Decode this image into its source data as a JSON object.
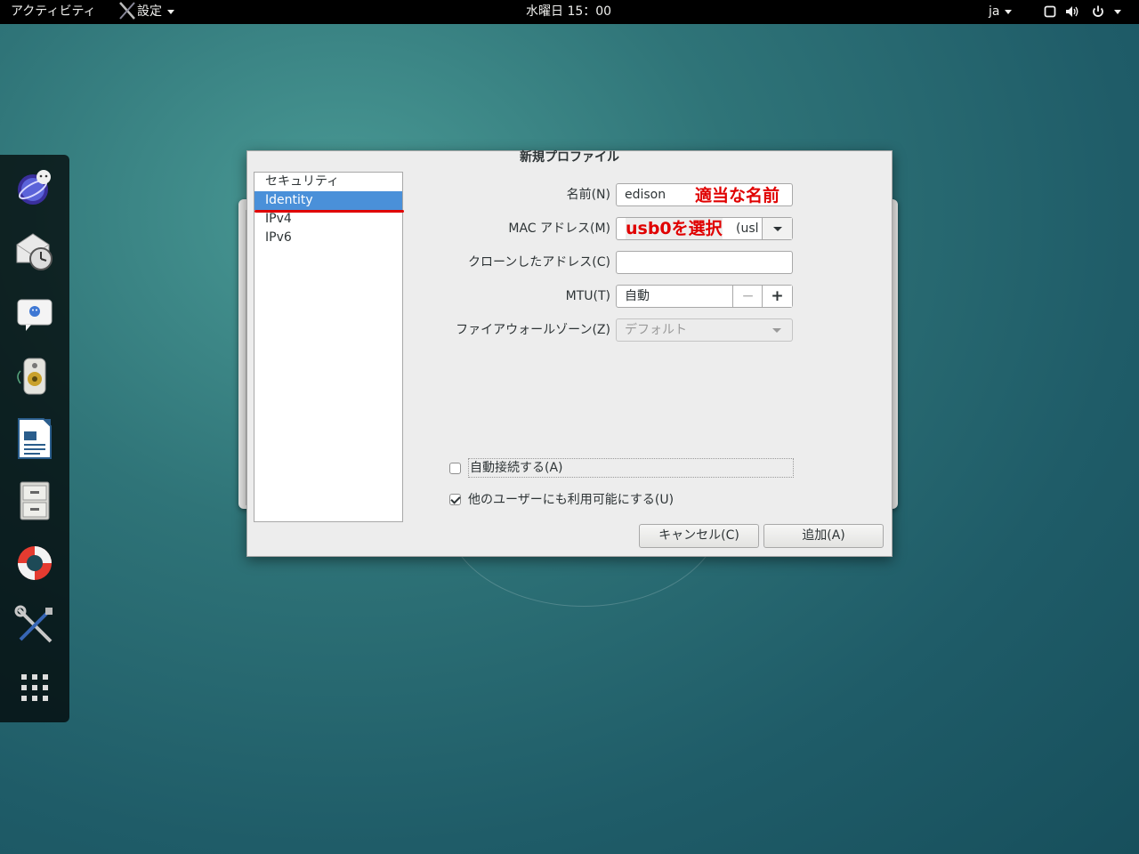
{
  "topbar": {
    "activities": "アクティビティ",
    "app_menu": "設定",
    "clock": "水曜日 15：00",
    "language": "ja"
  },
  "dash": {
    "items": [
      "browser-icon",
      "mail-clock-icon",
      "chat-icon",
      "speaker-icon",
      "writer-document-icon",
      "file-cabinet-icon",
      "help-lifebuoy-icon",
      "settings-tools-icon",
      "app-grid-icon"
    ]
  },
  "dialog": {
    "title": "新規プロファイル",
    "sidebar": [
      "セキュリティ",
      "Identity",
      "IPv4",
      "IPv6"
    ],
    "selected_index": 1,
    "fields": {
      "name_label": "名前(N)",
      "name_value": "edison",
      "name_annotation": "適当な名前",
      "mac_label": "MAC アドレス(M)",
      "mac_annotation": "usb0を選択",
      "mac_value_fragment": "(usl",
      "clone_label": "クローンしたアドレス(C)",
      "clone_value": "",
      "mtu_label": "MTU(T)",
      "mtu_value": "自動",
      "mtu_minus": "−",
      "mtu_plus": "+",
      "firewall_label": "ファイアウォールゾーン(Z)",
      "firewall_value": "デフォルト"
    },
    "checkboxes": {
      "autoconnect_label": "自動接続する(A)",
      "autoconnect_checked": false,
      "all_users_label": "他のユーザーにも利用可能にする(U)",
      "all_users_checked": true
    },
    "buttons": {
      "cancel": "キャンセル(C)",
      "add": "追加(A)"
    }
  }
}
